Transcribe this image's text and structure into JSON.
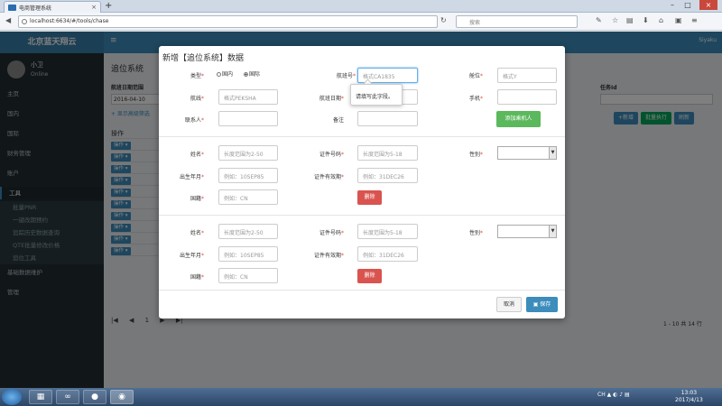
{
  "browser": {
    "tab_title": "电商管理系统",
    "url": "localhost:6634/#/tools/chase",
    "search_placeholder": "搜索"
  },
  "app": {
    "logo": "北京蓝天翔云",
    "user_name": "小卫",
    "user_status": "Online",
    "user_top": "Siyaku",
    "sidebar": [
      {
        "label": "主页"
      },
      {
        "label": "国内"
      },
      {
        "label": "国际"
      },
      {
        "label": "财务管理"
      },
      {
        "label": "账户"
      },
      {
        "label": "工具"
      },
      {
        "label": "批量PNR"
      },
      {
        "label": "一键改期预约"
      },
      {
        "label": "追踪历史数据查询"
      },
      {
        "label": "QTE批量修改价格"
      },
      {
        "label": "追位工具"
      },
      {
        "label": "基础数据维护"
      },
      {
        "label": "管理"
      }
    ],
    "page_title": "追位系统",
    "date_label": "航班日期范围",
    "date_value": "2016-04-10",
    "adv_filter": "+ 显示高级筛选",
    "batch_label": "任务Id",
    "tools": {
      "add": "+新增",
      "batch": "批量执行",
      "refresh": "刷新"
    },
    "table_header": "操作",
    "row_op": "操作 ▾",
    "pager": "|◀ ◀ 1 ▶ ▶|",
    "total": "1 - 10 共 14 行"
  },
  "modal": {
    "title": "新增【追位系统】数据",
    "type_label": "类型",
    "type_domestic": "国内",
    "type_intl": "国际",
    "flight_label": "航班号",
    "flight_placeholder": "格式CA1835",
    "cabin_label": "舱位",
    "cabin_placeholder": "格式Y",
    "route_label": "航线",
    "route_placeholder": "格式PEKSHA",
    "date_label": "航班日期",
    "phone_label": "手机",
    "contact_label": "联系人",
    "remark_label": "备注",
    "add_button": "添加乘机人",
    "tooltip": "请填写此字段。",
    "passengers": [
      {
        "name_label": "姓名",
        "name_placeholder": "长度范围为2-50",
        "id_label": "证件号码",
        "id_placeholder": "长度范围为5-18",
        "gender_label": "性别",
        "birth_label": "出生年月",
        "birth_placeholder": "例如：10SEP85",
        "expire_label": "证件有效期",
        "expire_placeholder": "例如：31DEC26",
        "nation_label": "国籍",
        "nation_placeholder": "例如：CN",
        "delete_label": "删除"
      },
      {
        "name_label": "姓名",
        "name_placeholder": "长度范围为2-50",
        "id_label": "证件号码",
        "id_placeholder": "长度范围为5-18",
        "gender_label": "性别",
        "birth_label": "出生年月",
        "birth_placeholder": "例如：10SEP85",
        "expire_label": "证件有效期",
        "expire_placeholder": "例如：31DEC26",
        "nation_label": "国籍",
        "nation_placeholder": "例如：CN",
        "delete_label": "删除"
      }
    ],
    "cancel_label": "取消",
    "save_label": "保存"
  },
  "taskbar": {
    "lang": "CH",
    "time": "13:03",
    "date": "2017/4/13"
  }
}
